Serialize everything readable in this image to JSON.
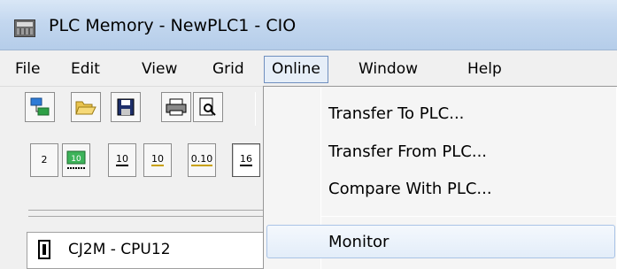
{
  "window": {
    "title": "PLC Memory - NewPLC1 - CIO"
  },
  "menubar": {
    "items": [
      {
        "label": "File"
      },
      {
        "label": "Edit"
      },
      {
        "label": "View"
      },
      {
        "label": "Grid"
      },
      {
        "label": "Online"
      },
      {
        "label": "Window"
      },
      {
        "label": "Help"
      }
    ]
  },
  "toolbar2": {
    "buttons": [
      {
        "label": "2"
      },
      {
        "label": "10"
      },
      {
        "label": "10"
      },
      {
        "label": "0.10"
      },
      {
        "label": "16"
      }
    ]
  },
  "dropdown": {
    "items": [
      {
        "label": "Transfer To PLC..."
      },
      {
        "label": "Transfer From PLC..."
      },
      {
        "label": "Compare With PLC..."
      },
      {
        "label": "Monitor"
      }
    ]
  },
  "tree": {
    "item": "CJ2M - CPU12"
  },
  "colors": {
    "titlebar": "#c3d7ef",
    "menu_open_border": "#6f8fbf",
    "highlight": "#e3edf9"
  }
}
